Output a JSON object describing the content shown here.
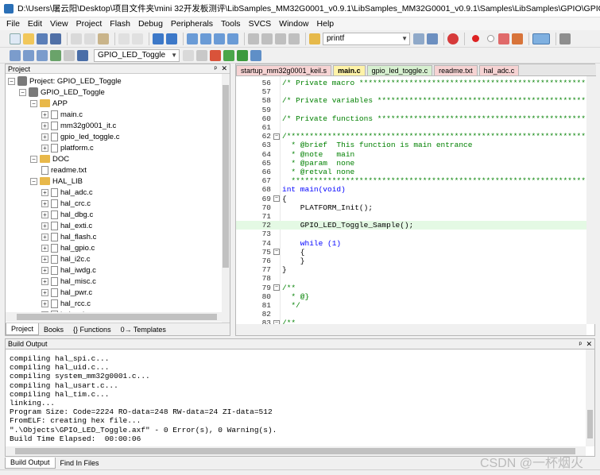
{
  "window": {
    "title": "D:\\Users\\屠云阳\\Desktop\\项目文件夹\\mini 32开发板测评\\LibSamples_MM32G0001_v0.9.1\\LibSamples_MM32G0001_v0.9.1\\Samples\\LibSamples\\GPIO\\GPIO_LED_Togg...",
    "minimize": "—",
    "maximize": "☐",
    "close": "✕"
  },
  "menu": [
    "File",
    "Edit",
    "View",
    "Project",
    "Flash",
    "Debug",
    "Peripherals",
    "Tools",
    "SVCS",
    "Window",
    "Help"
  ],
  "toolbar": {
    "find_combo": "printf",
    "target_combo": "GPIO_LED_Toggle"
  },
  "project_panel": {
    "title": "Project",
    "pin": "ᵖ",
    "close": "✕",
    "root": "Project: GPIO_LED_Toggle",
    "target": "GPIO_LED_Toggle",
    "groups": [
      {
        "name": "APP",
        "files": [
          "main.c",
          "mm32g0001_it.c",
          "gpio_led_toggle.c",
          "platform.c"
        ]
      },
      {
        "name": "DOC",
        "files": [
          "readme.txt"
        ]
      },
      {
        "name": "HAL_LIB",
        "files": [
          "hal_adc.c",
          "hal_crc.c",
          "hal_dbg.c",
          "hal_exti.c",
          "hal_flash.c",
          "hal_gpio.c",
          "hal_i2c.c",
          "hal_iwdg.c",
          "hal_misc.c",
          "hal_pwr.c",
          "hal_rcc.c",
          "hal_spi.c"
        ]
      }
    ],
    "tabs": [
      "Project",
      "Books",
      "{} Functions",
      "0→ Templates"
    ]
  },
  "editor": {
    "tabs": [
      {
        "label": "startup_mm32g0001_keil.s",
        "color": "#f6d3d3"
      },
      {
        "label": "main.c",
        "color": "#fff3a8",
        "active": true
      },
      {
        "label": "gpio_led_toggle.c",
        "color": "#d7f0d0"
      },
      {
        "label": "readme.txt",
        "color": "#f6d3d3"
      },
      {
        "label": "hal_adc.c",
        "color": "#f6d3d3"
      }
    ],
    "lines": [
      {
        "n": "56",
        "text": "/* Private macro ****************************************************",
        "cls": "cmt"
      },
      {
        "n": "57",
        "text": ""
      },
      {
        "n": "58",
        "text": "/* Private variables ************************************************",
        "cls": "cmt"
      },
      {
        "n": "59",
        "text": ""
      },
      {
        "n": "60",
        "text": "/* Private functions ************************************************",
        "cls": "cmt"
      },
      {
        "n": "61",
        "text": ""
      },
      {
        "n": "62",
        "text": "/*******************************************************************",
        "cls": "cmt",
        "fold": "−"
      },
      {
        "n": "63",
        "text": "  * @brief  This function is main entrance",
        "cls": "cmt"
      },
      {
        "n": "64",
        "text": "  * @note   main",
        "cls": "cmt"
      },
      {
        "n": "65",
        "text": "  * @param  none",
        "cls": "cmt"
      },
      {
        "n": "66",
        "text": "  * @retval none",
        "cls": "cmt"
      },
      {
        "n": "67",
        "text": "  *****************************************************************",
        "cls": "cmt"
      },
      {
        "n": "68",
        "text": "int main(void)",
        "cls": "kw"
      },
      {
        "n": "69",
        "text": "{",
        "fold": "−"
      },
      {
        "n": "70",
        "text": "    PLATFORM_Init();"
      },
      {
        "n": "71",
        "text": ""
      },
      {
        "n": "72",
        "text": "    GPIO_LED_Toggle_Sample();",
        "hl": true
      },
      {
        "n": "73",
        "text": ""
      },
      {
        "n": "74",
        "text": "    while (1)",
        "cls": "kw"
      },
      {
        "n": "75",
        "text": "    {",
        "fold": "−"
      },
      {
        "n": "76",
        "text": "    }"
      },
      {
        "n": "77",
        "text": "}"
      },
      {
        "n": "78",
        "text": ""
      },
      {
        "n": "79",
        "text": "/**",
        "cls": "cmt",
        "fold": "−"
      },
      {
        "n": "80",
        "text": "  * @}",
        "cls": "cmt"
      },
      {
        "n": "81",
        "text": "  */",
        "cls": "cmt"
      },
      {
        "n": "82",
        "text": ""
      },
      {
        "n": "83",
        "text": "/**",
        "cls": "cmt",
        "fold": "−"
      }
    ]
  },
  "build_output": {
    "title": "Build Output",
    "lines": [
      "compiling hal_spi.c...",
      "compiling hal_uid.c...",
      "compiling system_mm32g0001.c...",
      "compiling hal_usart.c...",
      "compiling hal_tim.c...",
      "linking...",
      "Program Size: Code=2224 RO-data=248 RW-data=24 ZI-data=512",
      "FromELF: creating hex file...",
      "\".\\Objects\\GPIO_LED_Toggle.axf\" - 0 Error(s), 0 Warning(s).",
      "Build Time Elapsed:  00:00:06"
    ],
    "tabs": [
      "Build Output",
      "Find In Files"
    ]
  },
  "watermark": "CSDN @一杯烟火"
}
